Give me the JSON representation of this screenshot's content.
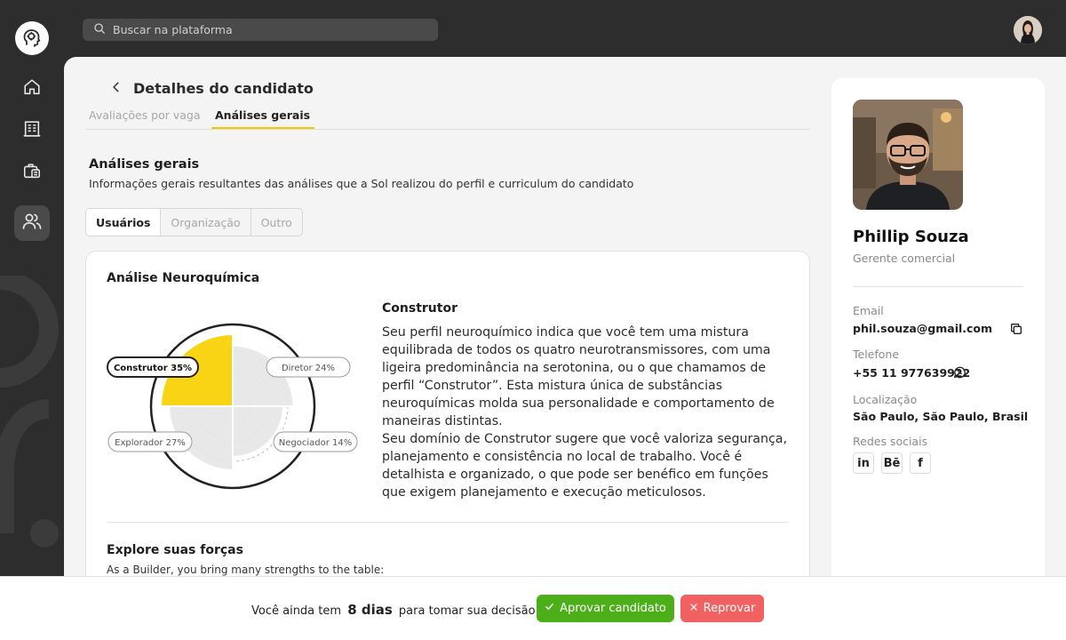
{
  "search": {
    "placeholder": "Buscar na plataforma"
  },
  "header": {
    "title": "Detalhes do candidato"
  },
  "tabs": [
    {
      "label": "Avaliações por vaga",
      "active": false
    },
    {
      "label": "Análises gerais",
      "active": true
    }
  ],
  "section": {
    "title": "Análises gerais",
    "subtitle": "Informações gerais resultantes das análises que a Sol realizou do perfil e curriculum do candidato"
  },
  "segments": [
    {
      "label": "Usuários",
      "active": true
    },
    {
      "label": "Organização",
      "active": false
    },
    {
      "label": "Outro",
      "active": false
    }
  ],
  "analysis": {
    "title": "Análise Neuroquímica",
    "profile_type": "Construtor",
    "description_1": "Seu perfil neuroquímico indica que você tem uma mistura equilibrada de todos os quatro neurotransmissores, com uma ligeira predominância na serotonina, ou o que chamamos de perfil “Construtor”. Esta mistura única de substâncias neuroquímicas molda sua personalidade e comportamento de maneiras distintas.",
    "description_2": "Seu domínio de Construtor sugere que você valoriza segurança, planejamento e consistência no local de trabalho. Você é detalhista e organizado, o que pode ser benéfico em funções que exigem planejamento e execução meticulosos.",
    "strengths_title": "Explore suas forças",
    "strengths_subtitle": "As a Builder, you bring many strengths to the table:"
  },
  "chart_data": {
    "type": "pie",
    "series": [
      {
        "name": "Construtor",
        "value": 35,
        "label": "Construtor 35%",
        "color": "#f9d414",
        "highlight": true
      },
      {
        "name": "Diretor",
        "value": 24,
        "label": "Diretor 24%",
        "color": "#e5e5e5"
      },
      {
        "name": "Negociador",
        "value": 14,
        "label": "Negociador 14%",
        "color": "#e5e5e5"
      },
      {
        "name": "Explorador",
        "value": 27,
        "label": "Explorador 27%",
        "color": "#e5e5e5"
      }
    ]
  },
  "profile": {
    "name": "Phillip Souza",
    "role": "Gerente comercial",
    "email_label": "Email",
    "email": "phil.souza@gmail.com",
    "phone_label": "Telefone",
    "phone": "+55 11 977639922",
    "location_label": "Localização",
    "location": "São Paulo, São Paulo, Brasil",
    "social_label": "Redes sociais",
    "social": [
      "in",
      "Bē",
      "f"
    ]
  },
  "decision": {
    "prefix": "Você ainda tem",
    "days": "8 dias",
    "suffix": "para tomar sua decisão:",
    "approve_label": "Aprovar candidato",
    "reject_label": "Reprovar"
  },
  "colors": {
    "accent": "#f9d414",
    "approve": "#4caf1a",
    "reject": "#f16161",
    "sidebar": "#2d2d2d"
  },
  "icons": {
    "logo": "brain-head-icon",
    "nav": [
      "home-icon",
      "building-icon",
      "briefcase-icon",
      "users-icon"
    ]
  }
}
